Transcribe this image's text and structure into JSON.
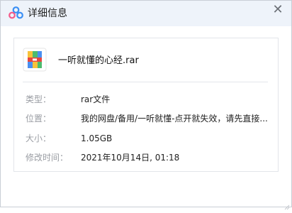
{
  "window": {
    "title": "详细信息",
    "close_glyph": "✕",
    "logo_icon": "baidu-netdisk-logo-icon"
  },
  "file": {
    "icon": "rar-archive-icon",
    "name": "一听就懂的心经.rar"
  },
  "details": {
    "type_label": "类型：",
    "type_value": "rar文件",
    "location_label": "位置：",
    "location_value": "我的网盘/备用/一听就懂-点开就失效，请先直接...",
    "size_label": "大小：",
    "size_value": "1.05GB",
    "modified_label": "修改时间：",
    "modified_value": "2021年10月14日, 01:18"
  },
  "colors": {
    "titlebar_bg": "#eef3fa",
    "logo_blue": "#3b8ff5",
    "logo_pink": "#f55a8a",
    "label_gray": "#9a9da3"
  }
}
